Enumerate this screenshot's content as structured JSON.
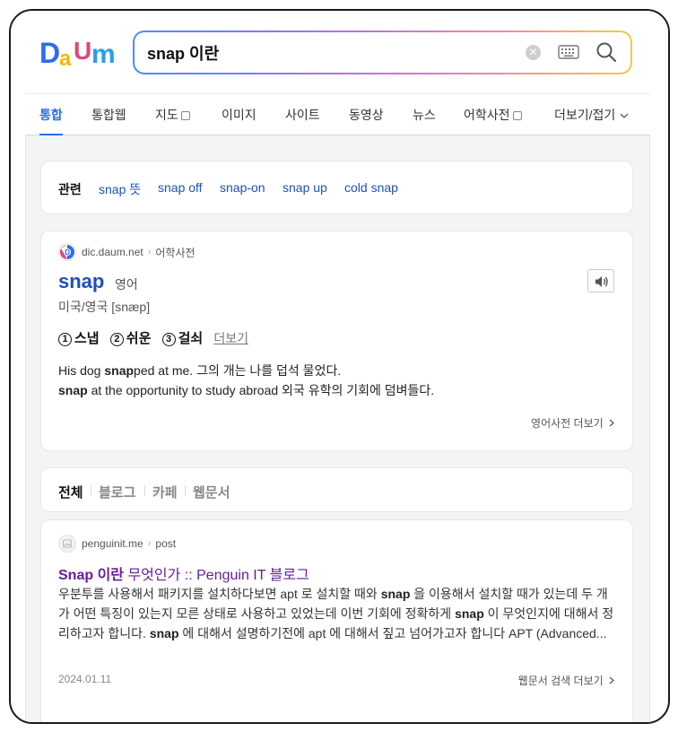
{
  "header": {
    "logo": {
      "letters": [
        "D",
        "a",
        "U",
        "m"
      ],
      "colors": [
        "#2a6df0",
        "#f5b800",
        "#e0457b",
        "#2a9ee5"
      ]
    },
    "search": {
      "query": "snap 이란",
      "placeholder": ""
    }
  },
  "tabs": [
    {
      "label": "통합",
      "active": true
    },
    {
      "label": "통합웹"
    },
    {
      "label": "지도"
    },
    {
      "label": "이미지"
    },
    {
      "label": "사이트"
    },
    {
      "label": "동영상"
    },
    {
      "label": "뉴스"
    },
    {
      "label": "어학사전"
    },
    {
      "label": "더보기/접기"
    }
  ],
  "related": {
    "label": "관련",
    "items": [
      "snap 뜻",
      "snap off",
      "snap-on",
      "snap up",
      "cold snap"
    ]
  },
  "dict": {
    "source": "dic.daum.net",
    "category": "어학사전",
    "word": "snap",
    "lang": "영어",
    "pronunciation": "미국/영국 [snæp]",
    "meanings": [
      {
        "num": "1",
        "text": "스냅"
      },
      {
        "num": "2",
        "text": "쉬운"
      },
      {
        "num": "3",
        "text": "걸쇠"
      }
    ],
    "more_label": "더보기",
    "examples": [
      {
        "pre": "His dog ",
        "bold": "snap",
        "post": "ped at me.  그의 개는 나를 덥석 물었다."
      },
      {
        "pre": "",
        "bold": "snap",
        "post": " at the opportunity to study abroad  외국 유학의 기회에 덤벼들다."
      }
    ],
    "footer_link": "영어사전 더보기"
  },
  "filters": {
    "items": [
      "전체",
      "블로그",
      "카페",
      "웹문서"
    ],
    "active_index": 0
  },
  "result": {
    "source": "penguinit.me",
    "path": "post",
    "title_bold": "Snap 이란",
    "title_rest": " 무엇인가 :: Penguin IT 블로그",
    "snippet": [
      {
        "t": "우분투를 사용해서 패키지를 설치하다보면 apt 로 설치할 때와 ",
        "b": false
      },
      {
        "t": "snap",
        "b": true
      },
      {
        "t": " 을 이용해서 설치할 때가 있는데 두 개가 어떤 특징이 있는지 모른 상태로 사용하고 있었는데 이번 기회에 정확하게 ",
        "b": false
      },
      {
        "t": "snap",
        "b": true
      },
      {
        "t": " 이 무엇인지에 대해서 정리하고자 합니다. ",
        "b": false
      },
      {
        "t": "snap",
        "b": true
      },
      {
        "t": " 에 대해서 설명하기전에 apt 에 대해서 짚고 넘어가고자 합니다 APT (Advanced...",
        "b": false
      }
    ],
    "date": "2024.01.11",
    "more_link": "웹문서 검색 더보기"
  },
  "colors": {
    "accent": "#2a6df0",
    "link": "#1c4fc2",
    "visited": "#6a1b9a"
  }
}
